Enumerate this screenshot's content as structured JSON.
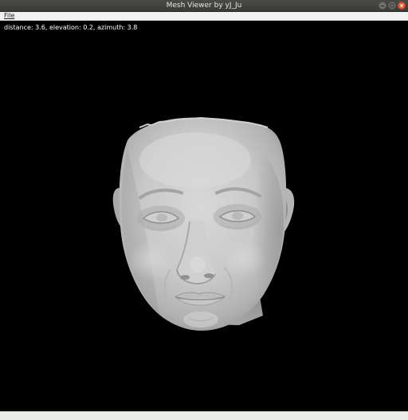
{
  "window": {
    "title": "Mesh Viewer by yJ_Ju",
    "controls": [
      "minimize-icon",
      "maximize-icon",
      "close-icon"
    ]
  },
  "menubar": {
    "items": [
      {
        "label": "File"
      }
    ]
  },
  "viewport": {
    "info": "distance: 3.6, elevation: 0.2, azimuth: 3.8",
    "background": "#000000",
    "mesh_color": "#c8c8c8"
  }
}
